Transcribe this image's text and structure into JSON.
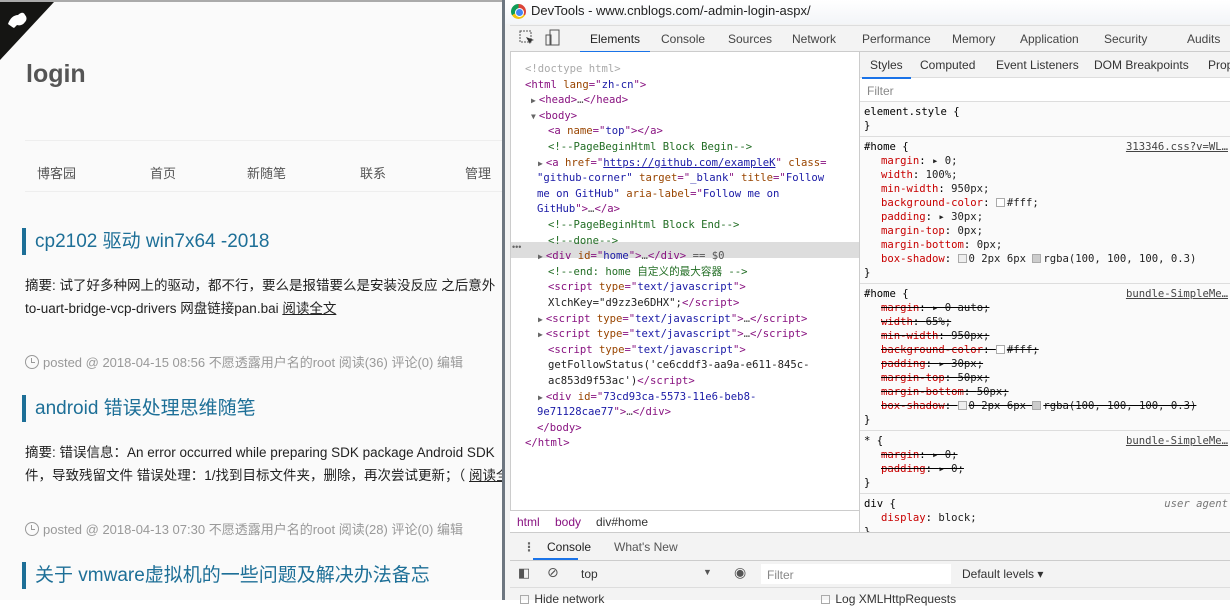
{
  "blog": {
    "title": "login",
    "nav": [
      "博客园",
      "首页",
      "新随笔",
      "联系",
      "管理"
    ],
    "posts": [
      {
        "title": "cp2102 驱动 win7x64 -2018",
        "summary_line1": "摘要: 试了好多种网上的驱动，都不行，要么是报错要么是安装没反应 之后意外",
        "summary_line2": "to-uart-bridge-vcp-drivers 网盘链接pan.bai ",
        "read_more": "阅读全文",
        "meta": "posted @ 2018-04-15 08:56 不愿透露用户名的root 阅读(36) 评论(0) 编辑"
      },
      {
        "title": "android 错误处理思维随笔",
        "summary_line1": "摘要: 错误信息：An error occurred while preparing SDK package Android SDK",
        "summary_line2": "件，导致残留文件 错误处理：1/找到目标文件夹，删除，再次尝试更新；（ ",
        "read_more": "阅读全文",
        "meta": "posted @ 2018-04-13 07:30 不愿透露用户名的root 阅读(28) 评论(0) 编辑"
      },
      {
        "title": "关于 vmware虚拟机的一些问题及解决办法备忘"
      }
    ]
  },
  "devtools": {
    "window_title": "DevTools - www.cnblogs.com/-admin-login-aspx/",
    "tabs": [
      "Elements",
      "Console",
      "Sources",
      "Network",
      "Performance",
      "Memory",
      "Application",
      "Security",
      "Audits"
    ],
    "active_tab": "Elements",
    "dom_lines": [
      [
        [
          "gray",
          "<!doctype html>"
        ]
      ],
      [
        [
          "tag",
          "<html "
        ],
        [
          "attr",
          "lang"
        ],
        [
          "tag",
          "=\""
        ],
        [
          "val",
          "zh-cn"
        ],
        [
          "tag",
          "\">"
        ]
      ],
      [
        [
          "tri",
          "▶"
        ],
        [
          "tag",
          "<head>"
        ],
        [
          "dim",
          "…"
        ],
        [
          "tag",
          "</head>"
        ]
      ],
      [
        [
          "tri",
          "▼"
        ],
        [
          "tag",
          "<body>"
        ]
      ],
      [
        [
          "tag",
          "<a "
        ],
        [
          "attr",
          "name"
        ],
        [
          "tag",
          "=\""
        ],
        [
          "val",
          "top"
        ],
        [
          "tag",
          "\"></a>"
        ]
      ],
      [
        [
          "cm",
          "<!--PageBeginHtml Block Begin-->"
        ]
      ],
      [
        [
          "tri",
          "▶"
        ],
        [
          "tag",
          "<a "
        ],
        [
          "attr",
          "href"
        ],
        [
          "tag",
          "=\""
        ],
        [
          "lnk",
          "https://github.com/exampleK"
        ],
        [
          "tag",
          "\" "
        ],
        [
          "attr",
          "class"
        ],
        [
          "tag",
          "="
        ]
      ],
      [
        [
          "val",
          "\"github-corner\" "
        ],
        [
          "attr",
          "target"
        ],
        [
          "tag",
          "=\""
        ],
        [
          "val",
          "_blank"
        ],
        [
          "tag",
          "\" "
        ],
        [
          "attr",
          "title"
        ],
        [
          "tag",
          "=\""
        ],
        [
          "val",
          "Follow"
        ]
      ],
      [
        [
          "val",
          "me on GitHub\" "
        ],
        [
          "attr",
          "aria-label"
        ],
        [
          "tag",
          "=\""
        ],
        [
          "val",
          "Follow me on"
        ]
      ],
      [
        [
          "val",
          "GitHub"
        ],
        [
          "tag",
          "\">"
        ],
        [
          "dim",
          "…"
        ],
        [
          "tag",
          "</a>"
        ]
      ],
      [
        [
          "cm",
          "<!--PageBeginHtml Block End-->"
        ]
      ],
      [
        [
          "cm",
          "<!--done-->"
        ]
      ],
      [
        [
          "tri",
          "▶"
        ],
        [
          "tag",
          "<div "
        ],
        [
          "attr",
          "id"
        ],
        [
          "tag",
          "=\""
        ],
        [
          "val",
          "home"
        ],
        [
          "tag",
          "\">"
        ],
        [
          "dim",
          "…"
        ],
        [
          "tag",
          "</div>"
        ],
        [
          "dim",
          " == $0"
        ]
      ],
      [
        [
          "cm",
          "<!--end: home 自定义的最大容器 -->"
        ]
      ],
      [
        [
          "tag",
          "<script "
        ],
        [
          "attr",
          "type"
        ],
        [
          "tag",
          "=\""
        ],
        [
          "val",
          "text/javascript"
        ],
        [
          "tag",
          "\">"
        ]
      ],
      [
        [
          "txt",
          "XlchKey=\"d9zz3e6DHX\";"
        ],
        [
          "tag",
          "</script>"
        ]
      ],
      [
        [
          "tri",
          "▶"
        ],
        [
          "tag",
          "<script "
        ],
        [
          "attr",
          "type"
        ],
        [
          "tag",
          "=\""
        ],
        [
          "val",
          "text/javascript"
        ],
        [
          "tag",
          "\">"
        ],
        [
          "dim",
          "…"
        ],
        [
          "tag",
          "</script>"
        ]
      ],
      [
        [
          "tri",
          "▶"
        ],
        [
          "tag",
          "<script "
        ],
        [
          "attr",
          "type"
        ],
        [
          "tag",
          "=\""
        ],
        [
          "val",
          "text/javascript"
        ],
        [
          "tag",
          "\">"
        ],
        [
          "dim",
          "…"
        ],
        [
          "tag",
          "</script>"
        ]
      ],
      [
        [
          "tag",
          "<script "
        ],
        [
          "attr",
          "type"
        ],
        [
          "tag",
          "=\""
        ],
        [
          "val",
          "text/javascript"
        ],
        [
          "tag",
          "\">"
        ]
      ],
      [
        [
          "txt",
          "getFollowStatus('ce6cddf3-aa9a-e611-845c-"
        ]
      ],
      [
        [
          "txt",
          "ac853d9f53ac')"
        ],
        [
          "tag",
          "</script>"
        ]
      ],
      [
        [
          "tri",
          "▶"
        ],
        [
          "tag",
          "<div "
        ],
        [
          "attr",
          "id"
        ],
        [
          "tag",
          "=\""
        ],
        [
          "val",
          "73cd93ca-5573-11e6-beb8-"
        ]
      ],
      [
        [
          "val",
          "9e71128cae77"
        ],
        [
          "tag",
          "\">"
        ],
        [
          "dim",
          "…"
        ],
        [
          "tag",
          "</div>"
        ]
      ],
      [
        [
          "tag",
          "</body>"
        ]
      ],
      [
        [
          "tag",
          "</html>"
        ]
      ]
    ],
    "breadcrumbs": [
      "html",
      "body",
      "div#home"
    ],
    "styles_tabs": [
      "Styles",
      "Computed",
      "Event Listeners",
      "DOM Breakpoints",
      "Prop"
    ],
    "styles_filter_placeholder": "Filter",
    "rules": [
      {
        "selector": "element.style {",
        "source": "",
        "props": []
      },
      {
        "selector": "#home {",
        "source": "313346.css?v=WL…",
        "props": [
          {
            "n": "margin",
            "v": "▸ 0;"
          },
          {
            "n": "width",
            "v": "100%;"
          },
          {
            "n": "min-width",
            "v": "950px;"
          },
          {
            "n": "background-color",
            "v": "#fff;",
            "sw": "#ffffff"
          },
          {
            "n": "padding",
            "v": "▸ 30px;"
          },
          {
            "n": "margin-top",
            "v": "0px;"
          },
          {
            "n": "margin-bottom",
            "v": "0px;"
          },
          {
            "n": "box-shadow",
            "v": "0 2px 6px ",
            "sw2": "rgba(100,100,100,0.3)",
            "v2": "rgba(100, 100, 100, 0.3)"
          }
        ]
      },
      {
        "selector": "#home {",
        "source": "bundle-SimpleMe…",
        "struck": true,
        "props": [
          {
            "n": "margin",
            "v": "▸ 0 auto;"
          },
          {
            "n": "width",
            "v": "65%;"
          },
          {
            "n": "min-width",
            "v": "950px;"
          },
          {
            "n": "background-color",
            "v": "#fff;",
            "sw": "#ffffff"
          },
          {
            "n": "padding",
            "v": "▸ 30px;"
          },
          {
            "n": "margin-top",
            "v": "50px;"
          },
          {
            "n": "margin-bottom",
            "v": "50px;"
          },
          {
            "n": "box-shadow",
            "v": "0 2px 6px ",
            "sw2": "rgba(100,100,100,0.3)",
            "v2": "rgba(100, 100, 100, 0.3)"
          }
        ]
      },
      {
        "selector": "* {",
        "source": "bundle-SimpleMe…",
        "struck": true,
        "props": [
          {
            "n": "margin",
            "v": "▸ 0;"
          },
          {
            "n": "padding",
            "v": "▸ 0;"
          }
        ]
      },
      {
        "selector": "div {",
        "source": "user agent",
        "ua": true,
        "props": [
          {
            "n": "display",
            "v": "block;"
          }
        ]
      }
    ],
    "drawer_tabs": [
      "Console",
      "What's New"
    ],
    "console_context": "top",
    "console_filter_placeholder": "Filter",
    "levels": "Default levels ▾",
    "hide_network": "Hide network",
    "log_xhr": "Log XMLHttpRequests"
  },
  "colors": {
    "accent": "#1a73e8",
    "post_title": "#1d6f97"
  }
}
